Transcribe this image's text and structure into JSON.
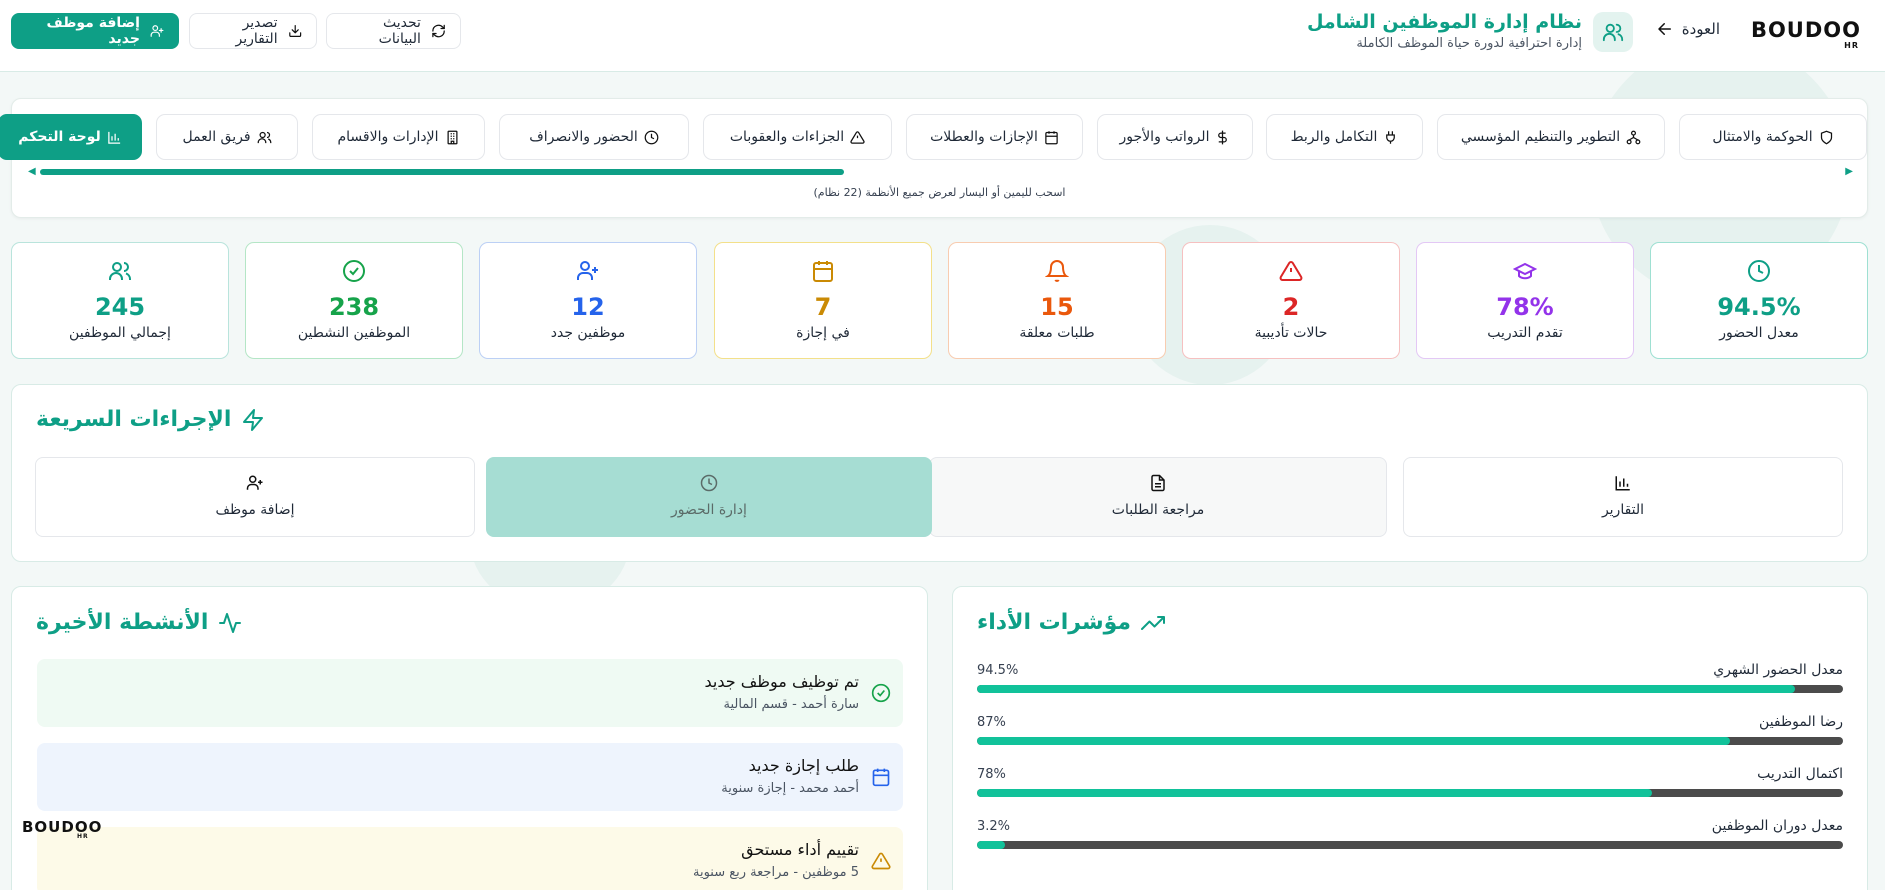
{
  "header": {
    "logo_text": "BOUDOO",
    "logo_sub": "HR",
    "back_label": "العودة",
    "title": "نظام إدارة الموظفين الشامل",
    "subtitle": "إدارة احترافية لدورة حياة الموظف الكاملة",
    "add_employee_label": "إضافة موظف جديد",
    "export_reports_label": "تصدير التقارير",
    "refresh_label": "تحديث البيانات"
  },
  "tabs": [
    {
      "label": "الحوكمة والامتثال",
      "icon": "shield-icon"
    },
    {
      "label": "التطوير والتنظيم المؤسسي",
      "icon": "org-chart-icon"
    },
    {
      "label": "التكامل والربط",
      "icon": "plug-icon"
    },
    {
      "label": "الرواتب والأجور",
      "icon": "dollar-icon"
    },
    {
      "label": "الإجازات والعطلات",
      "icon": "calendar-icon"
    },
    {
      "label": "الجزاءات والعقوبات",
      "icon": "warning-icon"
    },
    {
      "label": "الحضور والانصراف",
      "icon": "clock-icon"
    },
    {
      "label": "الإدارات والاقسام",
      "icon": "building-icon"
    },
    {
      "label": "فريق العمل",
      "icon": "users-icon"
    },
    {
      "label": "لوحة التحكم",
      "icon": "chart-icon",
      "active": true
    }
  ],
  "scroll_hint": "اسحب لليمين أو اليسار لعرض جميع الأنظمة (22 نظام)",
  "stats": [
    {
      "value": "94.5%",
      "label": "معدل الحضور",
      "color": "#0e9f86",
      "border": "#9ee0d2",
      "icon": "clock-icon"
    },
    {
      "value": "78%",
      "label": "تقدم التدريب",
      "color": "#9333ea",
      "border": "#e3c8f5",
      "icon": "graduation-cap-icon"
    },
    {
      "value": "2",
      "label": "حالات تأديبية",
      "color": "#dc2626",
      "border": "#f6c0c0",
      "icon": "warning-icon"
    },
    {
      "value": "15",
      "label": "طلبات معلقة",
      "color": "#ea580c",
      "border": "#f8ccb0",
      "icon": "bell-icon"
    },
    {
      "value": "7",
      "label": "في إجازة",
      "color": "#ca8a04",
      "border": "#f3e08a",
      "icon": "calendar-icon"
    },
    {
      "value": "12",
      "label": "موظفين جدد",
      "color": "#2563eb",
      "border": "#bcd0f5",
      "icon": "user-plus-icon"
    },
    {
      "value": "238",
      "label": "الموظفين النشطين",
      "color": "#16a34a",
      "border": "#b4e6c6",
      "icon": "check-circle-icon"
    },
    {
      "value": "245",
      "label": "إجمالي الموظفين",
      "color": "#0e9f86",
      "border": "#b9e4dc",
      "icon": "users-icon"
    }
  ],
  "quick_actions": {
    "title": "الإجراءات السريعة",
    "items": [
      {
        "label": "التقارير",
        "icon": "bar-chart-icon"
      },
      {
        "label": "مراجعة الطلبات",
        "icon": "document-icon"
      },
      {
        "label": "إدارة الحضور",
        "icon": "clock-icon",
        "highlight": true
      },
      {
        "label": "إضافة موظف",
        "icon": "user-plus-icon"
      }
    ]
  },
  "kpis": {
    "title": "مؤشرات الأداء",
    "items": [
      {
        "label": "معدل الحضور الشهري",
        "value": "94.5%",
        "percent": 94.5
      },
      {
        "label": "رضا الموظفين",
        "value": "87%",
        "percent": 87
      },
      {
        "label": "اكتمال التدريب",
        "value": "78%",
        "percent": 78
      },
      {
        "label": "معدل دوران الموظفين",
        "value": "3.2%",
        "percent": 3.2
      }
    ]
  },
  "activities": {
    "title": "الأنشطة الأخيرة",
    "items": [
      {
        "title": "تم توظيف موظف جديد",
        "sub": "سارة أحمد - قسم المالية",
        "bg": "#effaf3",
        "icon": "check-circle-icon",
        "color": "#16a34a"
      },
      {
        "title": "طلب إجازة جديد",
        "sub": "أحمد محمد - إجازة سنوية",
        "bg": "#eef4fd",
        "icon": "calendar-icon",
        "color": "#2563eb"
      },
      {
        "title": "تقييم أداء مستحق",
        "sub": "5 موظفين - مراجعة ربع سنوية",
        "bg": "#fdfae8",
        "icon": "warning-icon",
        "color": "#ca8a04"
      }
    ]
  },
  "watermark": "BOUDOO",
  "watermark_sub": "HR"
}
